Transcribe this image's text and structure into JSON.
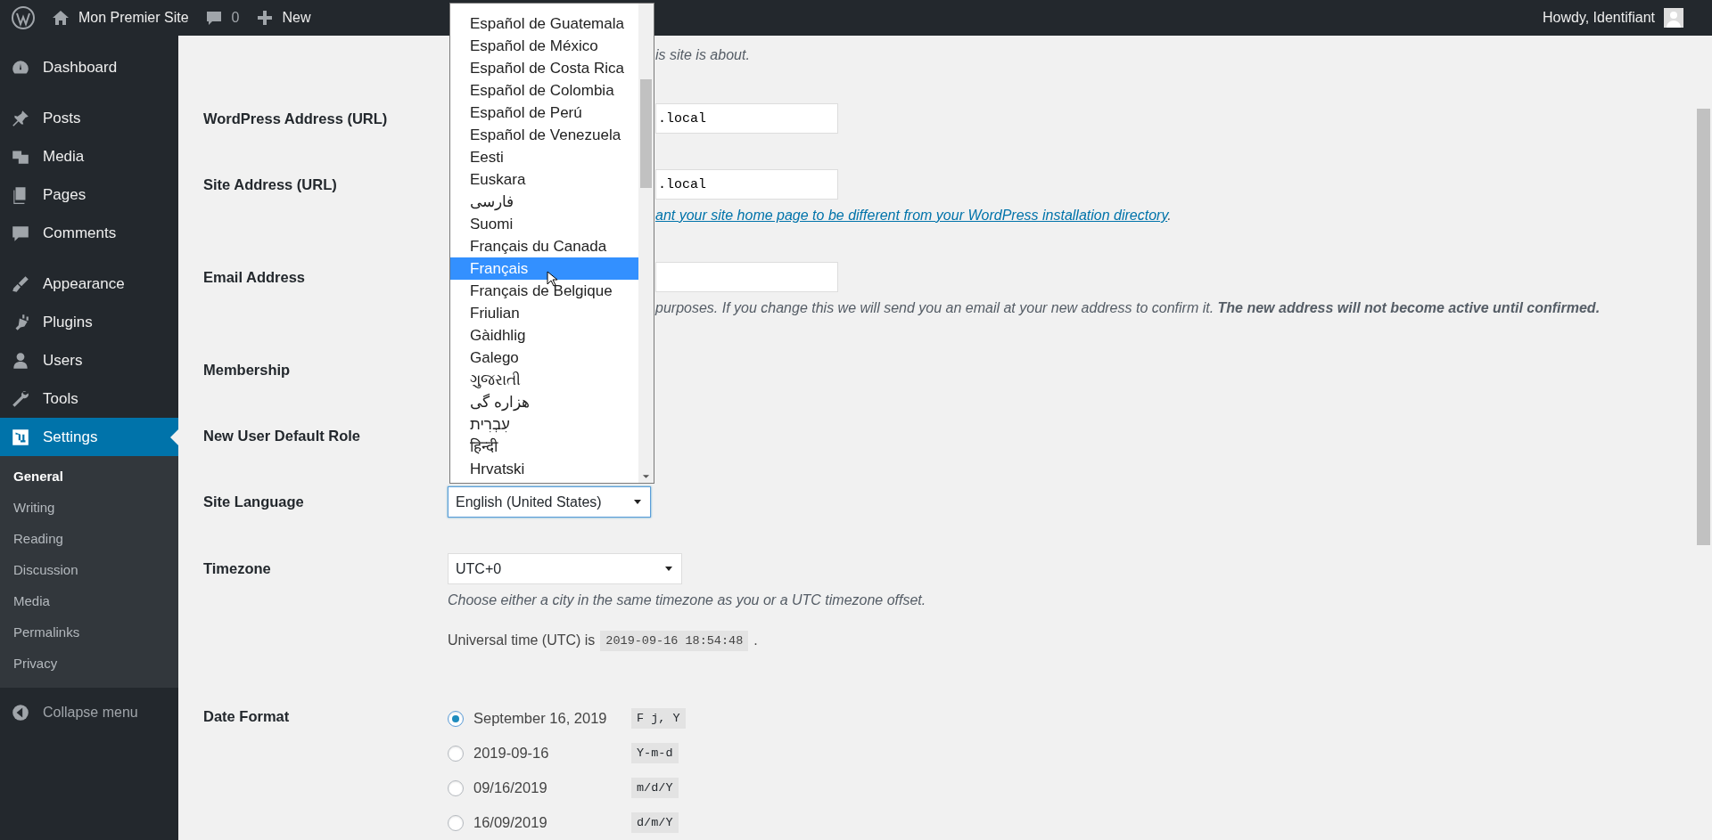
{
  "admin_bar": {
    "site_name": "Mon Premier Site",
    "comments_count": "0",
    "new_label": "New",
    "greeting": "Howdy, Identifiant"
  },
  "sidebar": {
    "groups": [
      {
        "items": [
          {
            "label": "Dashboard",
            "selected": false
          }
        ]
      },
      {
        "items": [
          {
            "label": "Posts",
            "selected": false
          },
          {
            "label": "Media",
            "selected": false
          },
          {
            "label": "Pages",
            "selected": false
          },
          {
            "label": "Comments",
            "selected": false
          }
        ]
      },
      {
        "items": [
          {
            "label": "Appearance",
            "selected": false
          },
          {
            "label": "Plugins",
            "selected": false
          },
          {
            "label": "Users",
            "selected": false
          },
          {
            "label": "Tools",
            "selected": false
          },
          {
            "label": "Settings",
            "selected": true
          }
        ]
      }
    ],
    "submenu": [
      {
        "label": "General",
        "selected": true
      },
      {
        "label": "Writing",
        "selected": false
      },
      {
        "label": "Reading",
        "selected": false
      },
      {
        "label": "Discussion",
        "selected": false
      },
      {
        "label": "Media",
        "selected": false
      },
      {
        "label": "Permalinks",
        "selected": false
      },
      {
        "label": "Privacy",
        "selected": false
      }
    ],
    "collapse_label": "Collapse menu"
  },
  "rows": [
    {
      "kind": "note",
      "hint": "is site is about."
    },
    {
      "kind": "input",
      "label": "WordPress Address (URL)",
      "value": ".local"
    },
    {
      "kind": "input",
      "label": "Site Address (URL)",
      "value": ".local",
      "hint_link": "ant your site home page to be different from your WordPress installation directory",
      "hint_suffix": "."
    },
    {
      "kind": "input",
      "label": "Email Address",
      "hint": "purposes. If you change this we will send you an email at your new address to confirm it. **The new address will not become active until confirmed.**"
    },
    {
      "kind": "label",
      "label": "Membership"
    },
    {
      "kind": "label",
      "label": "New User Default Role"
    },
    {
      "kind": "language",
      "label": "Site Language",
      "value": "English (United States)",
      "options": [
        {
          "label": "Español de Guatemala",
          "selected": false
        },
        {
          "label": "Español de México",
          "selected": false
        },
        {
          "label": "Español de Costa Rica",
          "selected": false
        },
        {
          "label": "Español de Colombia",
          "selected": false
        },
        {
          "label": "Español de Perú",
          "selected": false
        },
        {
          "label": "Español de Venezuela",
          "selected": false
        },
        {
          "label": "Eesti",
          "selected": false
        },
        {
          "label": "Euskara",
          "selected": false
        },
        {
          "label": "فارسی",
          "selected": false
        },
        {
          "label": "Suomi",
          "selected": false
        },
        {
          "label": "Français du Canada",
          "selected": false
        },
        {
          "label": "Français",
          "selected": true
        },
        {
          "label": "Français de Belgique",
          "selected": false
        },
        {
          "label": "Friulian",
          "selected": false
        },
        {
          "label": "Gàidhlig",
          "selected": false
        },
        {
          "label": "Galego",
          "selected": false
        },
        {
          "label": "ગુજરાતી",
          "selected": false
        },
        {
          "label": "هزاره گی",
          "selected": false
        },
        {
          "label": "עִבְרִית",
          "selected": false
        },
        {
          "label": "हिन्दी",
          "selected": false
        },
        {
          "label": "Hrvatski",
          "selected": false
        }
      ]
    },
    {
      "kind": "timezone",
      "label": "Timezone",
      "value": "UTC+0",
      "hint": "Choose either a city in the same timezone as you or a UTC timezone offset.",
      "utc_label": "Universal time (UTC) is",
      "utc_value": "2019-09-16 18:54:48",
      "utc_suffix": "."
    },
    {
      "kind": "radios",
      "label": "Date Format",
      "options": [
        {
          "label": "September 16, 2019",
          "format": "F j, Y",
          "selected": true
        },
        {
          "label": "2019-09-16",
          "format": "Y-m-d",
          "selected": false
        },
        {
          "label": "09/16/2019",
          "format": "m/d/Y",
          "selected": false
        },
        {
          "label": "16/09/2019",
          "format": "d/m/Y",
          "selected": false
        }
      ]
    }
  ]
}
